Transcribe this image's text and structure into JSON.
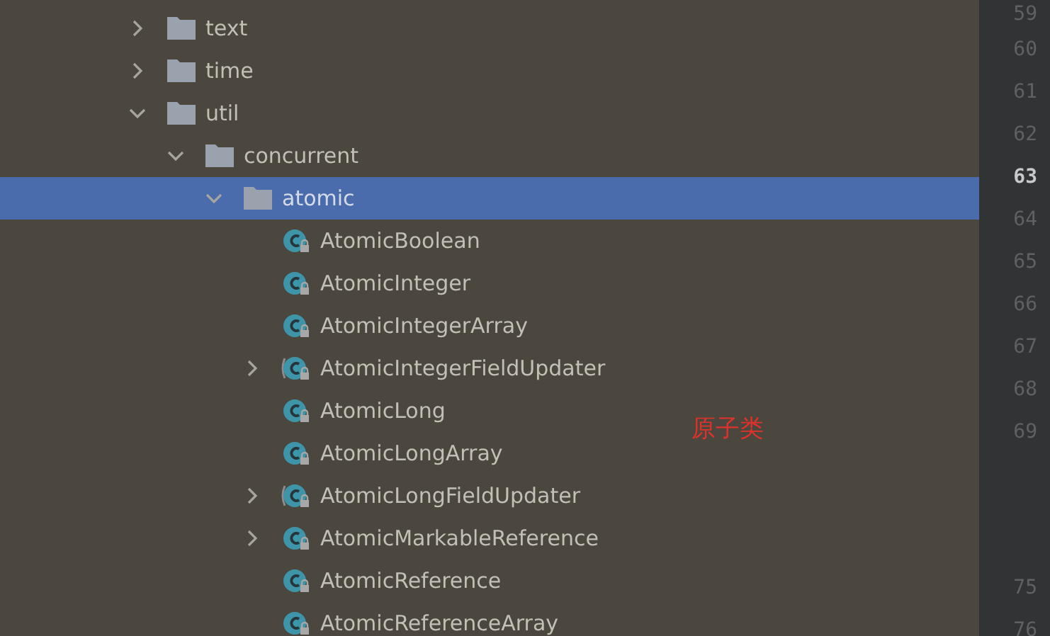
{
  "project_tree": {
    "items": [
      {
        "label": "text",
        "kind": "folder",
        "expanded": false,
        "selected": false
      },
      {
        "label": "time",
        "kind": "folder",
        "expanded": false,
        "selected": false
      },
      {
        "label": "util",
        "kind": "folder",
        "expanded": true,
        "selected": false,
        "children": [
          {
            "label": "concurrent",
            "kind": "folder",
            "expanded": true,
            "selected": false,
            "children": [
              {
                "label": "atomic",
                "kind": "folder",
                "expanded": true,
                "selected": true,
                "children": [
                  {
                    "label": "AtomicBoolean",
                    "kind": "class",
                    "selected": false
                  },
                  {
                    "label": "AtomicInteger",
                    "kind": "class",
                    "selected": false
                  },
                  {
                    "label": "AtomicIntegerArray",
                    "kind": "class",
                    "selected": false
                  },
                  {
                    "label": "AtomicIntegerFieldUpdater",
                    "kind": "abstract-class",
                    "expanded": false,
                    "selected": false
                  },
                  {
                    "label": "AtomicLong",
                    "kind": "class",
                    "selected": false
                  },
                  {
                    "label": "AtomicLongArray",
                    "kind": "class",
                    "selected": false
                  },
                  {
                    "label": "AtomicLongFieldUpdater",
                    "kind": "abstract-class",
                    "expanded": false,
                    "selected": false
                  },
                  {
                    "label": "AtomicMarkableReference",
                    "kind": "class",
                    "expanded": false,
                    "selected": false
                  },
                  {
                    "label": "AtomicReference",
                    "kind": "class",
                    "selected": false
                  },
                  {
                    "label": "AtomicReferenceArray",
                    "kind": "class",
                    "selected": false
                  }
                ]
              }
            ]
          }
        ]
      }
    ]
  },
  "annotation": "原子类",
  "gutter": {
    "lines": [
      {
        "kind": "number",
        "number": "59",
        "current": false
      },
      {
        "kind": "number",
        "number": "60",
        "current": false
      },
      {
        "kind": "number",
        "number": "61",
        "current": false
      },
      {
        "kind": "number",
        "number": "62",
        "current": false
      },
      {
        "kind": "number",
        "number": "63",
        "current": true
      },
      {
        "kind": "number",
        "number": "64",
        "current": false
      },
      {
        "kind": "number",
        "number": "65",
        "current": false
      },
      {
        "kind": "number",
        "number": "66",
        "current": false
      },
      {
        "kind": "number",
        "number": "67",
        "current": false
      },
      {
        "kind": "number",
        "number": "68",
        "current": false
      },
      {
        "kind": "number",
        "number": "69",
        "current": false
      },
      {
        "kind": "gap"
      },
      {
        "kind": "number",
        "number": "75",
        "current": false
      },
      {
        "kind": "number",
        "number": "76",
        "current": false
      }
    ]
  }
}
